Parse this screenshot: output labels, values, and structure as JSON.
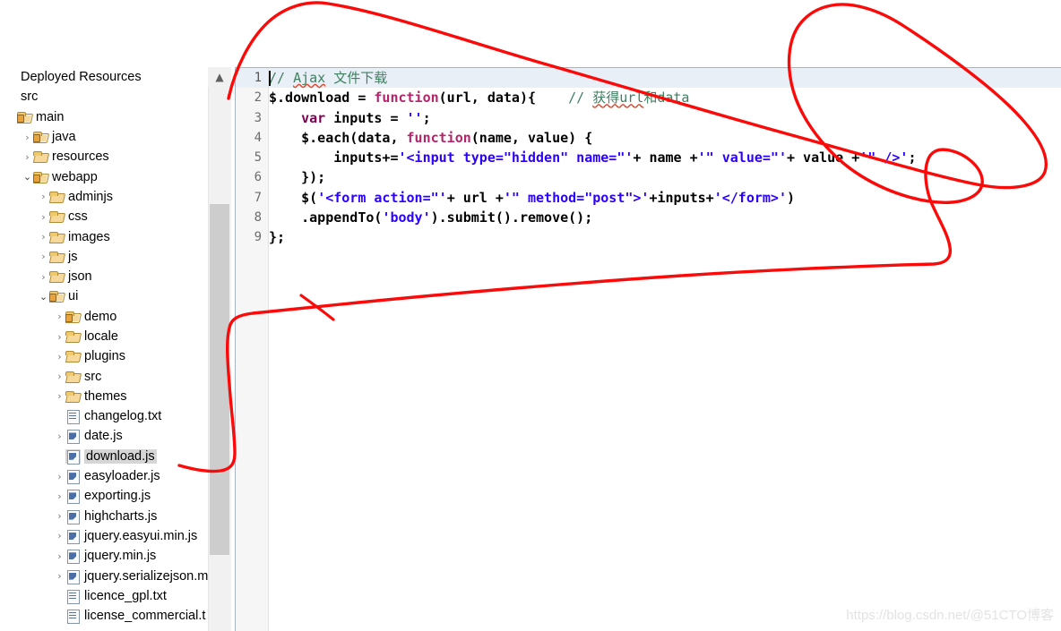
{
  "sidebar": {
    "title": "Deployed Resources",
    "scroll": {
      "up_icon": "chevron-up-icon"
    },
    "items": [
      {
        "label": "Deployed Resources",
        "indent": 0,
        "twisty": "",
        "icon": "none",
        "selected": false
      },
      {
        "label": "src",
        "indent": 0,
        "twisty": "",
        "icon": "none",
        "selected": false
      },
      {
        "label": "main",
        "indent": 0,
        "twisty": "",
        "icon": "src-folder",
        "selected": false
      },
      {
        "label": "java",
        "indent": 1,
        "twisty": ">",
        "icon": "src-folder",
        "selected": false
      },
      {
        "label": "resources",
        "indent": 1,
        "twisty": ">",
        "icon": "folder",
        "selected": false
      },
      {
        "label": "webapp",
        "indent": 1,
        "twisty": "v",
        "icon": "src-folder",
        "selected": false
      },
      {
        "label": "adminjs",
        "indent": 2,
        "twisty": ">",
        "icon": "folder",
        "selected": false
      },
      {
        "label": "css",
        "indent": 2,
        "twisty": ">",
        "icon": "folder",
        "selected": false
      },
      {
        "label": "images",
        "indent": 2,
        "twisty": ">",
        "icon": "folder",
        "selected": false
      },
      {
        "label": "js",
        "indent": 2,
        "twisty": ">",
        "icon": "folder",
        "selected": false
      },
      {
        "label": "json",
        "indent": 2,
        "twisty": ">",
        "icon": "folder",
        "selected": false
      },
      {
        "label": "ui",
        "indent": 2,
        "twisty": "v",
        "icon": "src-folder",
        "selected": false
      },
      {
        "label": "demo",
        "indent": 3,
        "twisty": ">",
        "icon": "src-folder",
        "selected": false
      },
      {
        "label": "locale",
        "indent": 3,
        "twisty": ">",
        "icon": "folder",
        "selected": false
      },
      {
        "label": "plugins",
        "indent": 3,
        "twisty": ">",
        "icon": "folder",
        "selected": false
      },
      {
        "label": "src",
        "indent": 3,
        "twisty": ">",
        "icon": "folder",
        "selected": false
      },
      {
        "label": "themes",
        "indent": 3,
        "twisty": ">",
        "icon": "folder",
        "selected": false
      },
      {
        "label": "changelog.txt",
        "indent": 3,
        "twisty": "",
        "icon": "txt-file",
        "selected": false
      },
      {
        "label": "date.js",
        "indent": 3,
        "twisty": ">",
        "icon": "js-file",
        "selected": false
      },
      {
        "label": "download.js",
        "indent": 3,
        "twisty": "",
        "icon": "js-file",
        "selected": true
      },
      {
        "label": "easyloader.js",
        "indent": 3,
        "twisty": ">",
        "icon": "js-file",
        "selected": false
      },
      {
        "label": "exporting.js",
        "indent": 3,
        "twisty": ">",
        "icon": "js-file",
        "selected": false
      },
      {
        "label": "highcharts.js",
        "indent": 3,
        "twisty": ">",
        "icon": "js-file",
        "selected": false
      },
      {
        "label": "jquery.easyui.min.js",
        "indent": 3,
        "twisty": ">",
        "icon": "js-file",
        "selected": false
      },
      {
        "label": "jquery.min.js",
        "indent": 3,
        "twisty": ">",
        "icon": "js-file",
        "selected": false
      },
      {
        "label": "jquery.serializejson.m",
        "indent": 3,
        "twisty": ">",
        "icon": "js-file",
        "selected": false
      },
      {
        "label": "licence_gpl.txt",
        "indent": 3,
        "twisty": "",
        "icon": "txt-file",
        "selected": false
      },
      {
        "label": "license_commercial.t",
        "indent": 3,
        "twisty": "",
        "icon": "txt-file",
        "selected": false
      }
    ]
  },
  "editor": {
    "filename": "download.js",
    "current_line": 1,
    "line_numbers": [
      "1",
      "2",
      "3",
      "4",
      "5",
      "6",
      "7",
      "8",
      "9"
    ],
    "lines": [
      {
        "n": "1",
        "text": "// Ajax 文件下载"
      },
      {
        "n": "2",
        "text": "$.download = function(url, data){    // 获得url和data"
      },
      {
        "n": "3",
        "text": "    var inputs = '';"
      },
      {
        "n": "4",
        "text": "    $.each(data, function(name, value) {"
      },
      {
        "n": "5",
        "text": "        inputs+='<input type=\"hidden\" name=\"'+ name +'\" value=\"'+ value +'\" />';"
      },
      {
        "n": "6",
        "text": "    });"
      },
      {
        "n": "7",
        "text": "    $('<form action=\"'+ url +'\" method=\"post\">'+inputs+'</form>')"
      },
      {
        "n": "8",
        "text": "    .appendTo('body').submit().remove();"
      },
      {
        "n": "9",
        "text": "};"
      }
    ]
  },
  "annotation": {
    "name": "red-freehand-highlight",
    "color": "#fb0a0a",
    "stroke_width": 3.4
  },
  "watermark": {
    "text": "https://blog.csdn.net/@51CTO博客"
  },
  "colors": {
    "comment": "#3f7f5f",
    "keyword": "#7f0055",
    "function": "#b5246b",
    "string": "#2a00ff",
    "current_line": "#e8eff7",
    "selection": "#d6d6d6",
    "scrollbar_thumb": "#cdcdcd",
    "annotation_red": "#fb0a0a"
  }
}
